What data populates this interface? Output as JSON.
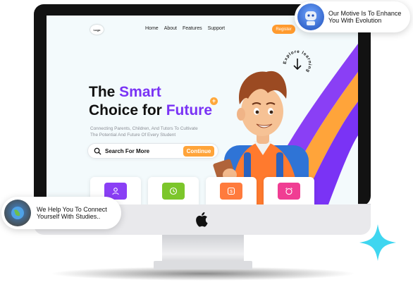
{
  "nav": {
    "logo_text": "Logo",
    "links": [
      "Home",
      "About",
      "Features",
      "Support"
    ],
    "register_label": "Register"
  },
  "hero": {
    "line1_plain": "The ",
    "line1_accent": "Smart",
    "line2_plain": "Choice for ",
    "line2_accent": "Future",
    "subtitle_line1": "Connecting Parents, Children, And Tutors To Cultivate",
    "subtitle_line2": "The Potential And Future Of Every Student",
    "search_value": "Search For More",
    "continue_label": "Continue",
    "explore_text": "Explore learning"
  },
  "cards": [
    {
      "icon": "user-icon",
      "color": "#8a3ff5"
    },
    {
      "icon": "clock-icon",
      "color": "#7cc62b"
    },
    {
      "icon": "dollar-icon",
      "color": "#ff7b3d"
    },
    {
      "icon": "alarm-icon",
      "color": "#f03d93"
    }
  ],
  "badges": {
    "top_line1": "Our Motive Is To Enhance",
    "top_line2": "You With Evolution",
    "bottom_line1": "We Help You To Connect",
    "bottom_line2": "Yourself With Studies.."
  },
  "colors": {
    "accent_purple": "#7a33f5",
    "accent_orange": "#ffa43a",
    "sparkle": "#3fd6f0"
  }
}
